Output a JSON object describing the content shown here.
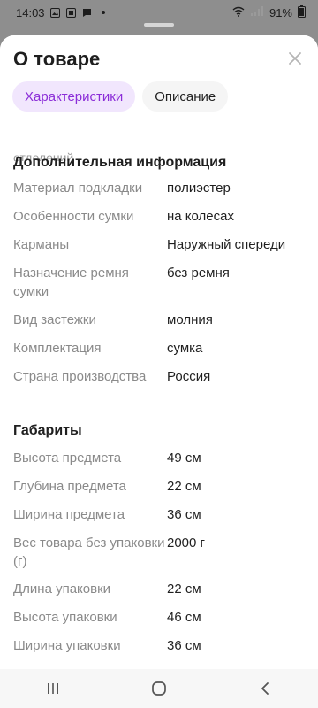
{
  "status_bar": {
    "time": "14:03",
    "battery": "91%"
  },
  "sheet": {
    "title": "О товаре",
    "tabs": [
      {
        "label": "Характеристики",
        "active": true
      },
      {
        "label": "Описание",
        "active": false
      }
    ],
    "cut_row_text": "отделений"
  },
  "sections": [
    {
      "title": "Дополнительная информация",
      "rows": [
        {
          "label": "Материал подкладки",
          "value": "полиэстер"
        },
        {
          "label": "Особенности сумки",
          "value": "на колесах"
        },
        {
          "label": "Карманы",
          "value": "Наружный спереди"
        },
        {
          "label": "Назначение ремня сумки",
          "value": "без ремня"
        },
        {
          "label": "Вид застежки",
          "value": "молния"
        },
        {
          "label": "Комплектация",
          "value": "сумка"
        },
        {
          "label": "Страна производства",
          "value": "Россия"
        }
      ]
    },
    {
      "title": "Габариты",
      "rows": [
        {
          "label": "Высота предмета",
          "value": "49 см"
        },
        {
          "label": "Глубина предмета",
          "value": "22 см"
        },
        {
          "label": "Ширина предмета",
          "value": "36 см"
        },
        {
          "label": "Вес товара без упаковки (г)",
          "value": "2000 г"
        },
        {
          "label": "Длина упаковки",
          "value": "22 см"
        },
        {
          "label": "Высота упаковки",
          "value": "46 см"
        },
        {
          "label": "Ширина упаковки",
          "value": "36 см"
        }
      ]
    }
  ],
  "colors": {
    "accent": "#8b2dd8",
    "accent_bg": "#f1e6fd",
    "label": "#8a8a8a",
    "text": "#1f1f1f"
  }
}
